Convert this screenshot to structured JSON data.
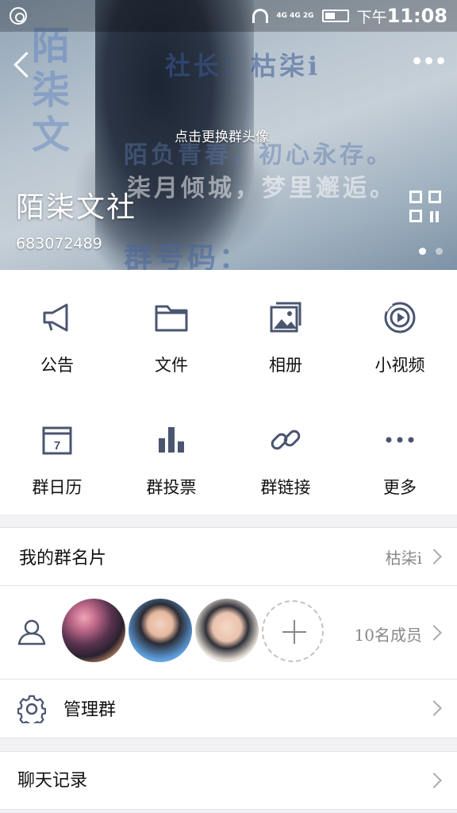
{
  "status_bar": {
    "network": "4G 4G 2G",
    "ampm": "下午",
    "time": "11:08"
  },
  "header": {
    "overlay_line1": "社长：枯柒i",
    "overlay_line2": "陌负青春，初心永存。",
    "overlay_line3": "柒月倾城，梦里邂逅。",
    "overlay_line4": "群号码：683072489",
    "overlay_vertical": "陌柒文",
    "change_avatar": "点击更换群头像",
    "group_name": "陌柒文社",
    "group_id": "683072489"
  },
  "features": [
    {
      "label": "公告",
      "icon": "megaphone-icon"
    },
    {
      "label": "文件",
      "icon": "folder-icon"
    },
    {
      "label": "相册",
      "icon": "photo-album-icon"
    },
    {
      "label": "小视频",
      "icon": "video-play-icon"
    },
    {
      "label": "群日历",
      "icon": "calendar-icon"
    },
    {
      "label": "群投票",
      "icon": "bar-chart-icon"
    },
    {
      "label": "群链接",
      "icon": "link-icon"
    },
    {
      "label": "更多",
      "icon": "more-dots-icon"
    }
  ],
  "my_card": {
    "label": "我的群名片",
    "value": "枯柒i"
  },
  "members": {
    "count_label": "10名成员"
  },
  "manage": {
    "label": "管理群"
  },
  "chat_history": {
    "label": "聊天记录"
  },
  "colors": {
    "icon": "#4a5570",
    "accent_blue": "#3a6fb0"
  }
}
